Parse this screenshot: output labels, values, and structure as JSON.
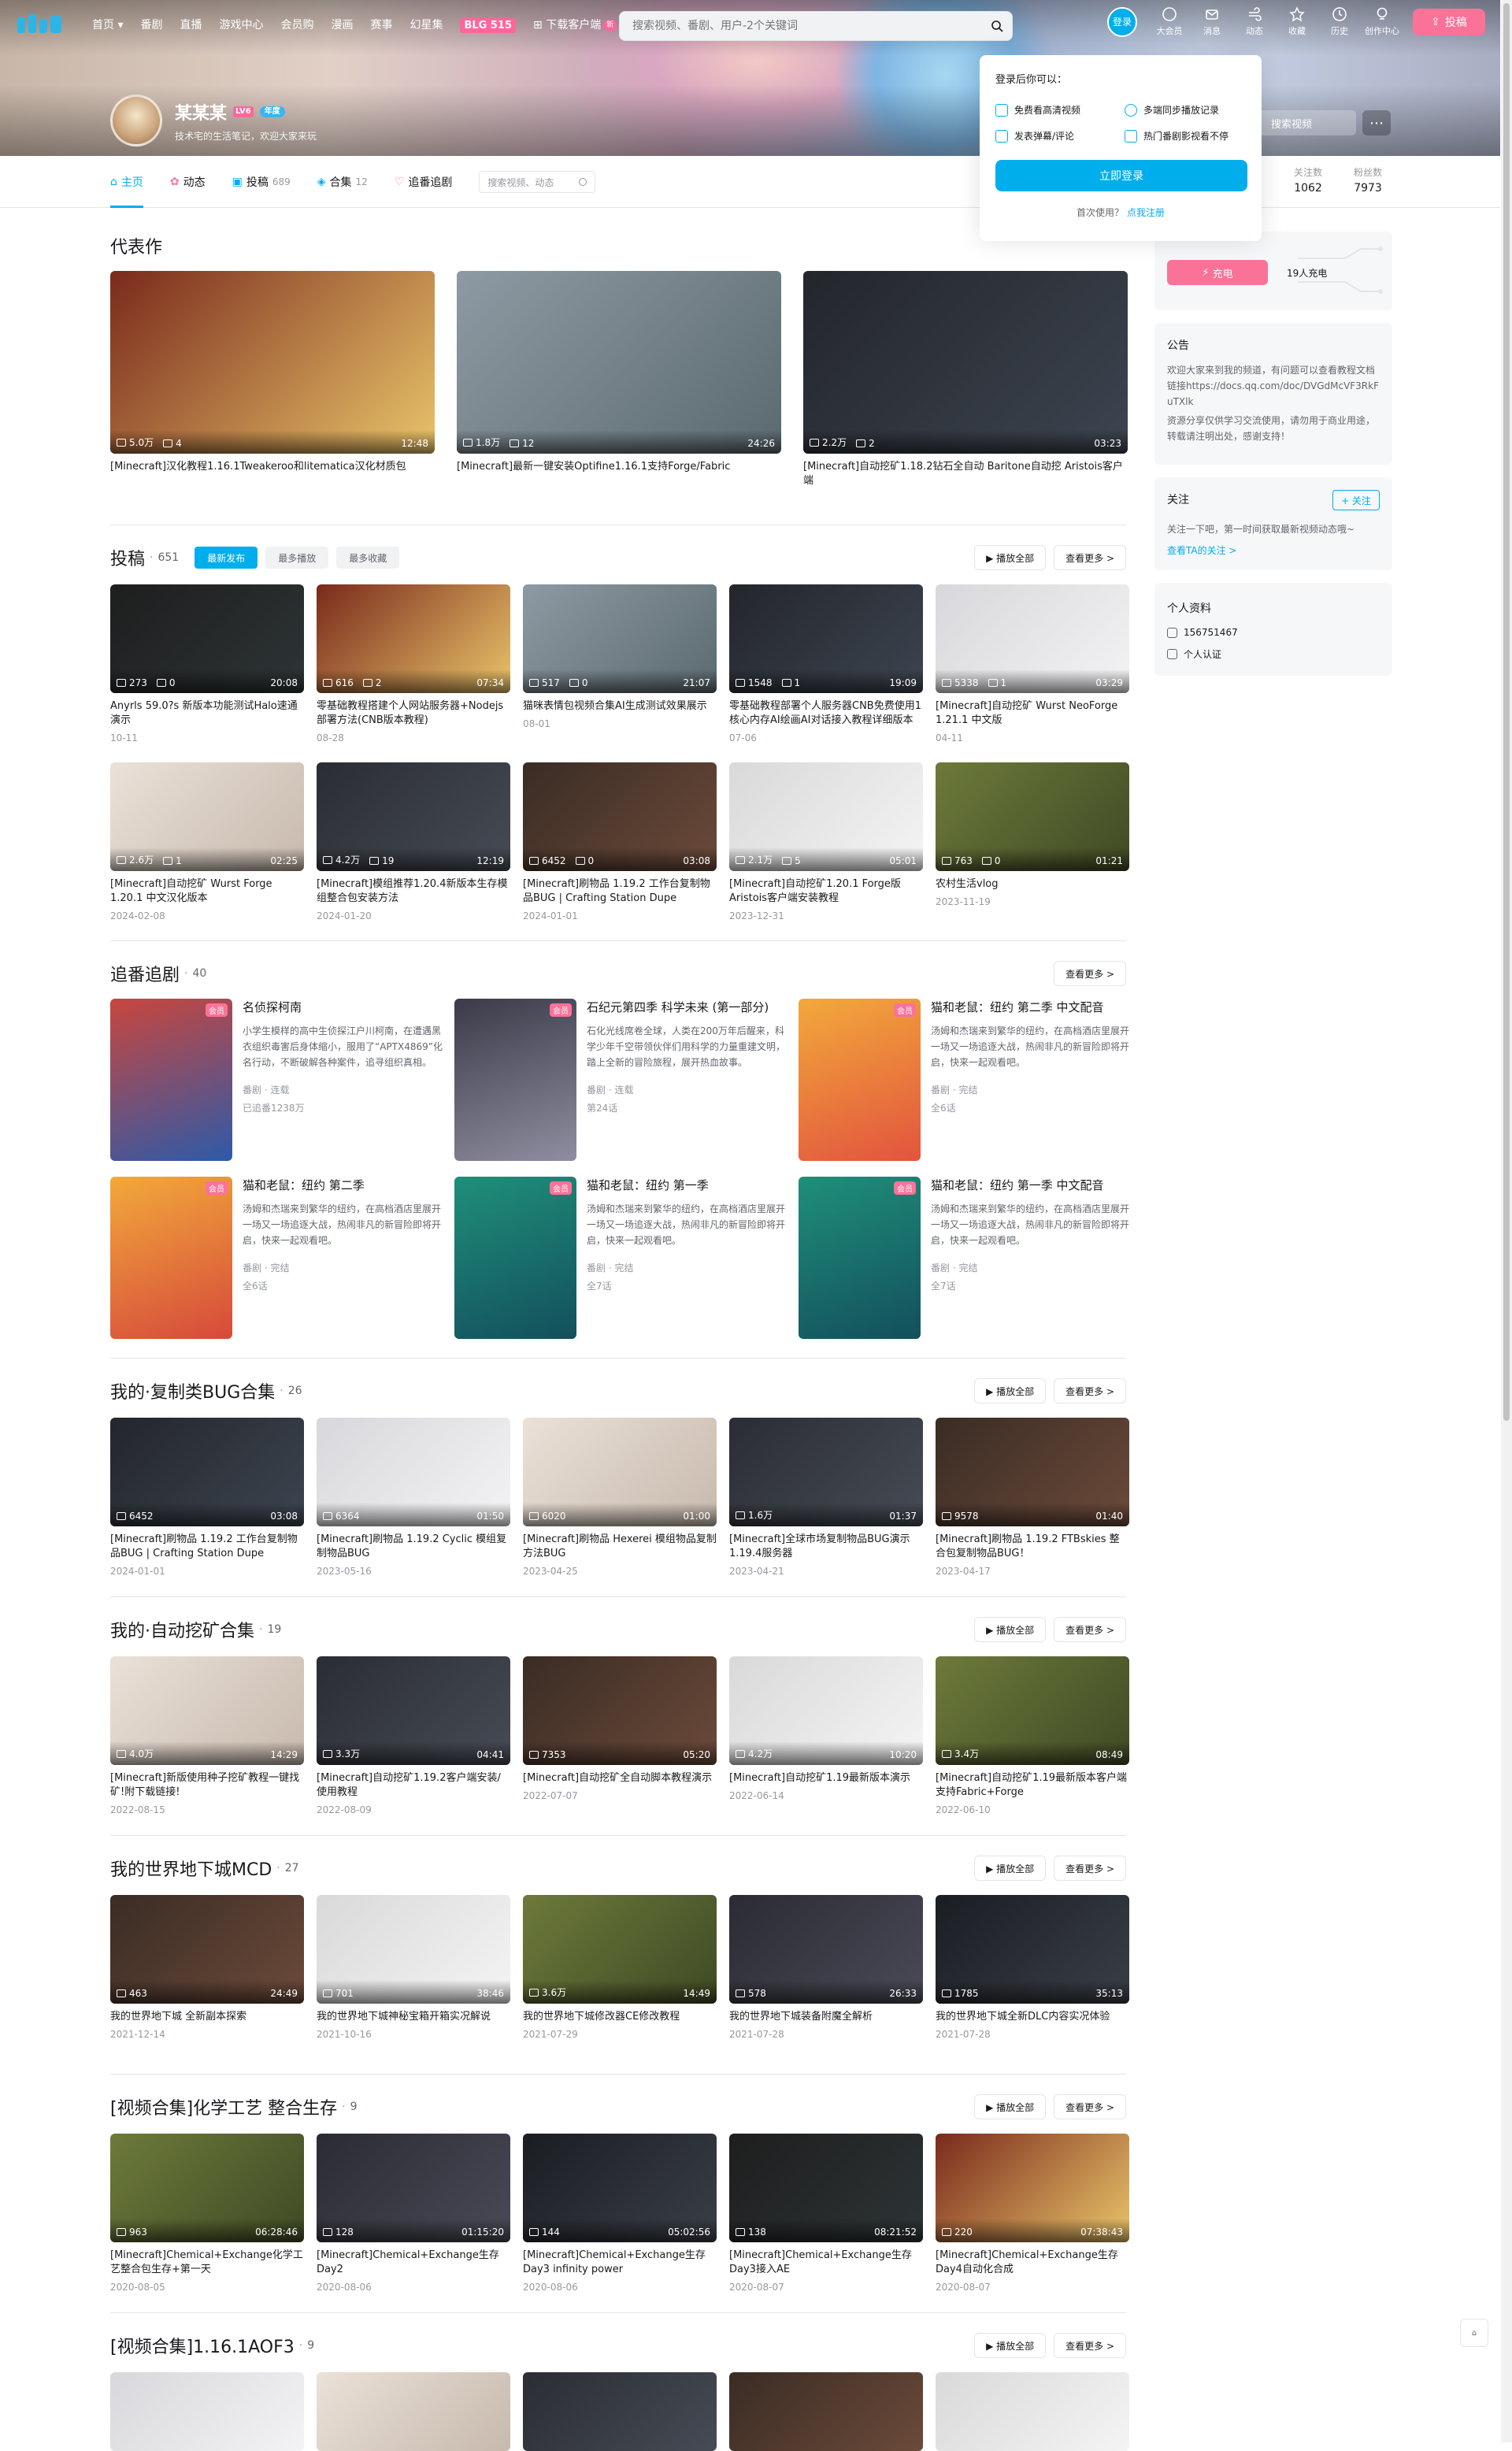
{
  "nav": {
    "items": [
      {
        "label": "首页",
        "caret": true
      },
      {
        "label": "番剧"
      },
      {
        "label": "直播"
      },
      {
        "label": "游戏中心"
      },
      {
        "label": "会员购"
      },
      {
        "label": "漫画"
      },
      {
        "label": "赛事"
      },
      {
        "label": "幻星集"
      }
    ],
    "game_label": "BLG 515",
    "download_label": "下载客户端",
    "download_badge": "新",
    "search_placeholder": "搜索视频、番剧、用户-2个关键词",
    "avatar_label": "登录",
    "right_items": [
      "大会员",
      "消息",
      "动态",
      "收藏",
      "历史",
      "创作中心"
    ],
    "upload_label": "投稿"
  },
  "user": {
    "name": "某某某",
    "level": "LV6",
    "vip": "年度",
    "signature": "技术宅的生活笔记，欢迎大家来玩",
    "banner_search": "搜索视频"
  },
  "login_popup": {
    "title": "登录后你可以：",
    "benefits": [
      "免费看高清视频",
      "多端同步播放记录",
      "发表弹幕/评论",
      "热门番剧影视看不停"
    ],
    "login_button": "立即登录",
    "register_prefix": "首次使用？",
    "register_link": "点我注册"
  },
  "tabs": [
    {
      "label": "主页",
      "count": ""
    },
    {
      "label": "动态",
      "count": ""
    },
    {
      "label": "投稿",
      "count": "689"
    },
    {
      "label": "合集",
      "count": "12"
    },
    {
      "label": "追番追剧",
      "count": ""
    }
  ],
  "tab_search_placeholder": "搜索视频、动态",
  "stats": [
    {
      "label": "关注数",
      "value": "1062"
    },
    {
      "label": "粉丝数",
      "value": "7973"
    }
  ],
  "sections": {
    "pinned": {
      "title": "代表作",
      "videos": [
        {
          "title": "[Minecraft]汉化教程1.16.1Tweakeroo和litematica汉化材质包",
          "plays": "5.0万",
          "comments": "4",
          "duration": "12:48"
        },
        {
          "title": "[Minecraft]最新一键安装Optifine1.16.1支持Forge/Fabric",
          "plays": "1.8万",
          "comments": "12",
          "duration": "24:26"
        },
        {
          "title": "[Minecraft]自动挖矿1.18.2钻石全自动 Baritone自动挖 Aristois客户端",
          "plays": "2.2万",
          "comments": "2",
          "duration": "03:23"
        }
      ]
    },
    "submissions": {
      "title": "投稿",
      "count": "651",
      "filters": [
        "最新发布",
        "最多播放",
        "最多收藏"
      ],
      "play_all": "▶ 播放全部",
      "more": "查看更多 >",
      "videos": [
        {
          "title": "Anyrls 59.0?s 新版本功能测试Halo速通演示",
          "plays": "273",
          "comments": "0",
          "duration": "20:08",
          "date": "10-11"
        },
        {
          "title": "零基础教程搭建个人网站服务器+Nodejs部署方法(CNB版本教程)",
          "plays": "616",
          "comments": "2",
          "duration": "07:34",
          "date": "08-28"
        },
        {
          "title": "猫咪表情包视频合集AI生成测试效果展示",
          "plays": "517",
          "comments": "0",
          "duration": "21:07",
          "date": "08-01"
        },
        {
          "title": "零基础教程部署个人服务器CNB免费使用1核心内存AI绘画AI对话接入教程详细版本",
          "plays": "1548",
          "comments": "1",
          "duration": "19:09",
          "date": "07-06"
        },
        {
          "title": "[Minecraft]自动挖矿 Wurst NeoForge 1.21.1 中文版",
          "plays": "5338",
          "comments": "1",
          "duration": "03:29",
          "date": "04-11"
        },
        {
          "title": "[Minecraft]自动挖矿 Wurst Forge 1.20.1 中文汉化版本",
          "plays": "2.6万",
          "comments": "1",
          "duration": "02:25",
          "date": "2024-02-08"
        },
        {
          "title": "[Minecraft]模组推荐1.20.4新版本生存模组整合包安装方法",
          "plays": "4.2万",
          "comments": "19",
          "duration": "12:19",
          "date": "2024-01-20"
        },
        {
          "title": "[Minecraft]刷物品 1.19.2 工作台复制物品BUG | Crafting Station Dupe",
          "plays": "6452",
          "comments": "0",
          "duration": "03:08",
          "date": "2024-01-01"
        },
        {
          "title": "[Minecraft]自动挖矿1.20.1 Forge版Aristois客户端安装教程",
          "plays": "2.1万",
          "comments": "5",
          "duration": "05:01",
          "date": "2023-12-31"
        },
        {
          "title": "农村生活vlog",
          "plays": "763",
          "comments": "0",
          "duration": "01:21",
          "date": "2023-11-19"
        }
      ]
    },
    "series": {
      "title": "追番追剧",
      "count": "40",
      "more": "查看更多 >",
      "items": [
        {
          "title": "名侦探柯南",
          "desc": "小学生模样的高中生侦探江户川柯南，在遭遇黑衣组织毒害后身体缩小，服用了“APTX4869”化名行动，不断破解各种案件，追寻组织真相。",
          "meta": "番剧 · 连载",
          "stat": "已追番1238万",
          "badge": "会员"
        },
        {
          "title": "石纪元第四季 科学未来 (第一部分)",
          "desc": "石化光线席卷全球，人类在200万年后醒来，科学少年千空带领伙伴们用科学的力量重建文明，踏上全新的冒险旅程，展开热血故事。",
          "meta": "番剧 · 连载",
          "stat": "第24话",
          "badge": "会员"
        },
        {
          "title": "猫和老鼠：纽约 第二季 中文配音",
          "desc": "汤姆和杰瑞来到繁华的纽约，在高档酒店里展开一场又一场追逐大战，热闹非凡的新冒险即将开启，快来一起观看吧。",
          "meta": "番剧 · 完结",
          "stat": "全6话",
          "badge": "会员"
        },
        {
          "title": "猫和老鼠：纽约 第二季",
          "desc": "汤姆和杰瑞来到繁华的纽约，在高档酒店里展开一场又一场追逐大战，热闹非凡的新冒险即将开启，快来一起观看吧。",
          "meta": "番剧 · 完结",
          "stat": "全6话",
          "badge": "会员"
        },
        {
          "title": "猫和老鼠：纽约 第一季",
          "desc": "汤姆和杰瑞来到繁华的纽约，在高档酒店里展开一场又一场追逐大战，热闹非凡的新冒险即将开启，快来一起观看吧。",
          "meta": "番剧 · 完结",
          "stat": "全7话",
          "badge": "会员"
        },
        {
          "title": "猫和老鼠：纽约 第一季 中文配音",
          "desc": "汤姆和杰瑞来到繁华的纽约，在高档酒店里展开一场又一场追逐大战，热闹非凡的新冒险即将开启，快来一起观看吧。",
          "meta": "番剧 · 完结",
          "stat": "全7话",
          "badge": "会员"
        }
      ]
    },
    "col1": {
      "title": "我的·复制类BUG合集",
      "count": "26",
      "play_all": "▶ 播放全部",
      "more": "查看更多 >",
      "videos": [
        {
          "title": "[Minecraft]刷物品 1.19.2 工作台复制物品BUG | Crafting Station Dupe",
          "plays": "6452",
          "duration": "03:08",
          "date": "2024-01-01"
        },
        {
          "title": "[Minecraft]刷物品 1.19.2 Cyclic 模组复制物品BUG",
          "plays": "6364",
          "duration": "01:50",
          "date": "2023-05-16"
        },
        {
          "title": "[Minecraft]刷物品 Hexerei 模组物品复制方法BUG",
          "plays": "6020",
          "duration": "01:00",
          "date": "2023-04-25"
        },
        {
          "title": "[Minecraft]全球市场复制物品BUG演示1.19.4服务器",
          "plays": "1.6万",
          "duration": "01:37",
          "date": "2023-04-21"
        },
        {
          "title": "[Minecraft]刷物品 1.19.2 FTBskies 整合包复制物品BUG！",
          "plays": "9578",
          "duration": "01:40",
          "date": "2023-04-17"
        }
      ]
    },
    "col2": {
      "title": "我的·自动挖矿合集",
      "count": "19",
      "play_all": "▶ 播放全部",
      "more": "查看更多 >",
      "videos": [
        {
          "title": "[Minecraft]新版使用种子挖矿教程一键找矿!附下载链接!",
          "plays": "4.0万",
          "duration": "14:29",
          "date": "2022-08-15"
        },
        {
          "title": "[Minecraft]自动挖矿1.19.2客户端安装/使用教程",
          "plays": "3.3万",
          "duration": "04:41",
          "date": "2022-08-09"
        },
        {
          "title": "[Minecraft]自动挖矿全自动脚本教程演示",
          "plays": "7353",
          "duration": "05:20",
          "date": "2022-07-07"
        },
        {
          "title": "[Minecraft]自动挖矿1.19最新版本演示",
          "plays": "4.2万",
          "duration": "10:20",
          "date": "2022-06-14"
        },
        {
          "title": "[Minecraft]自动挖矿1.19最新版本客户端支持Fabric+Forge",
          "plays": "3.4万",
          "duration": "08:49",
          "date": "2022-06-10"
        }
      ]
    },
    "col3": {
      "title": "我的世界地下城MCD",
      "count": "27",
      "play_all": "▶ 播放全部",
      "more": "查看更多 >",
      "videos": [
        {
          "title": "我的世界地下城 全新副本探索",
          "plays": "463",
          "duration": "24:49",
          "date": "2021-12-14"
        },
        {
          "title": "我的世界地下城神秘宝箱开箱实况解说",
          "plays": "701",
          "duration": "38:46",
          "date": "2021-10-16"
        },
        {
          "title": "我的世界地下城修改器CE修改教程",
          "plays": "3.6万",
          "duration": "14:49",
          "date": "2021-07-29"
        },
        {
          "title": "我的世界地下城装备附魔全解析",
          "plays": "578",
          "duration": "26:33",
          "date": "2021-07-28"
        },
        {
          "title": "我的世界地下城全新DLC内容实况体验",
          "plays": "1785",
          "duration": "35:13",
          "date": "2021-07-28"
        }
      ]
    },
    "col4": {
      "title": "[视频合集]化学工艺 整合生存",
      "count": "9",
      "play_all": "▶ 播放全部",
      "more": "查看更多 >",
      "videos": [
        {
          "title": "[Minecraft]Chemical+Exchange化学工艺整合包生存+第一天",
          "plays": "963",
          "duration": "06:28:46",
          "date": "2020-08-05"
        },
        {
          "title": "[Minecraft]Chemical+Exchange生存Day2",
          "plays": "128",
          "duration": "01:15:20",
          "date": "2020-08-06"
        },
        {
          "title": "[Minecraft]Chemical+Exchange生存Day3 infinity power",
          "plays": "144",
          "duration": "05:02:56",
          "date": "2020-08-06"
        },
        {
          "title": "[Minecraft]Chemical+Exchange生存Day3接入AE",
          "plays": "138",
          "duration": "08:21:52",
          "date": "2020-08-07"
        },
        {
          "title": "[Minecraft]Chemical+Exchange生存Day4自动化合成",
          "plays": "220",
          "duration": "07:38:43",
          "date": "2020-08-07"
        }
      ]
    },
    "col5": {
      "title": "[视频合集]1.16.1AOF3",
      "count": "9",
      "play_all": "▶ 播放全部",
      "more": "查看更多 >"
    }
  },
  "side": {
    "charge_button": "充电",
    "charge_count": "19人充电",
    "notice_title": "公告",
    "notice_text1": "欢迎大家来到我的频道，有问题可以查看教程文档链接https://docs.qq.com/doc/DVGdMcVF3RkFuTXlk",
    "notice_text2": "资源分享仅供学习交流使用，请勿用于商业用途，转载请注明出处，感谢支持！",
    "follow_title": "关注",
    "follow_button": "+ 关注",
    "follow_text": "关注一下吧，第一时间获取最新视频动态哦~",
    "follow_link": "查看TA的关注 >",
    "info_title": "个人资料",
    "uid": "156751467",
    "tag": "个人认证"
  },
  "colors": {
    "accent": "#00aeec",
    "pink": "#fb7299"
  }
}
